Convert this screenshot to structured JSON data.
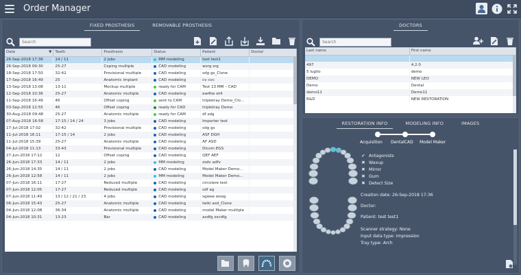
{
  "app": {
    "title": "Order Manager"
  },
  "left": {
    "tabs": [
      "FIXED PROSTHESIS",
      "REMOVABLE PROSTHESIS"
    ],
    "active_tab": 0,
    "search": {
      "placeholder": "Search",
      "value": ""
    },
    "columns": [
      "Date",
      "Teeth",
      "Prosthesis",
      "Status",
      "Patient",
      "Doctor"
    ],
    "rows": [
      {
        "date": "26-Sep-2018 17:36",
        "teeth": "14 / 11",
        "prosthesis": "2 jobs",
        "status": "MM modeling",
        "color": "#29c6e0",
        "patient": "test test1",
        "doctor": ""
      },
      {
        "date": "26-Sep-2018 09:30",
        "teeth": "25-27",
        "prosthesis": "Coping multiple",
        "status": "CAD modeling",
        "color": "#1f5fb0",
        "patient": "wsrg srg",
        "doctor": ""
      },
      {
        "date": "18-Sep-2018 17:50",
        "teeth": "32-42",
        "prosthesis": "Provisional multiple",
        "status": "CAD modeling",
        "color": "#1f5fb0",
        "patient": "sdg gs_Clone",
        "doctor": ""
      },
      {
        "date": "17-Sep-2018 16:49",
        "teeth": "25",
        "prosthesis": "Anatomic implant",
        "status": "CAD modeling",
        "color": "#1f5fb0",
        "patient": "cv cvc",
        "doctor": ""
      },
      {
        "date": "13-Sep-2018 13:08",
        "teeth": "13-11",
        "prosthesis": "Mockup multiple",
        "status": "ready for CAM",
        "color": "#3ccf3c",
        "patient": "Test 13 MM – CAD",
        "doctor": ""
      },
      {
        "date": "12-Sep-2018 10:36",
        "teeth": "25-27",
        "prosthesis": "Anatomic multiple",
        "status": "CAD modeling",
        "color": "#1f5fb0",
        "patient": "ew4tw et4",
        "doctor": ""
      },
      {
        "date": "11-Sep-2018 16:49",
        "teeth": "46",
        "prosthesis": "Offset coping",
        "status": "sent to CAM",
        "color": "#3ccf3c",
        "patient": "tripletray Demo_Clo...",
        "doctor": ""
      },
      {
        "date": "03-Sep-2018 12:55",
        "teeth": "46",
        "prosthesis": "Offset coping",
        "status": "ready for CAD",
        "color": "#2e7d32",
        "patient": "tripletray Demo",
        "doctor": ""
      },
      {
        "date": "30-Aug-2018 09:48",
        "teeth": "25-27",
        "prosthesis": "Anatomic multiple",
        "status": "ready for CAM",
        "color": "#3ccf3c",
        "patient": "df sdg",
        "doctor": ""
      },
      {
        "date": "07-Aug-2018 16:58",
        "teeth": "17-15 / 14 / 24",
        "prosthesis": "3 jobs",
        "status": "CAD modeling",
        "color": "#1f5fb0",
        "patient": "Importer test",
        "doctor": ""
      },
      {
        "date": "17-Jul-2018 17:02",
        "teeth": "32-42",
        "prosthesis": "Provisional multiple",
        "status": "CAD modeling",
        "color": "#1f5fb0",
        "patient": "sdg gs",
        "doctor": ""
      },
      {
        "date": "11-Jul-2018 16:11",
        "teeth": "17-15 / 14",
        "prosthesis": "2 jobs",
        "status": "CAD modeling",
        "color": "#1f5fb0",
        "patient": "ASF DGH",
        "doctor": ""
      },
      {
        "date": "11-Jul-2018 15:39",
        "teeth": "25-27",
        "prosthesis": "Anatomic multiple",
        "status": "CAD modeling",
        "color": "#1f5fb0",
        "patient": "AF ASD",
        "doctor": ""
      },
      {
        "date": "04-Jul-2018 11:13",
        "teeth": "33-43",
        "prosthesis": "Provisional multiple",
        "status": "CAD modeling",
        "color": "#1f5fb0",
        "patient": "Dicom EGS",
        "doctor": ""
      },
      {
        "date": "27-Jun-2018 17:12",
        "teeth": "12",
        "prosthesis": "Offset coping",
        "status": "CAD modeling",
        "color": "#1f5fb0",
        "patient": "QEF AEF",
        "doctor": ""
      },
      {
        "date": "26-Jun-2018 17:33",
        "teeth": "14 / 11",
        "prosthesis": "2 jobs",
        "status": "MM modeling",
        "color": "#29c6e0",
        "patient": "zsdv adfv",
        "doctor": ""
      },
      {
        "date": "26-Jun-2018 14:35",
        "teeth": "14 / 11",
        "prosthesis": "2 jobs",
        "status": "CAD modeling",
        "color": "#1f5fb0",
        "patient": "Model Maker Demo...",
        "doctor": ""
      },
      {
        "date": "26-Jun-2018 12:58",
        "teeth": "14 / 11",
        "prosthesis": "2 jobs",
        "status": "MM modeling",
        "color": "#29c6e0",
        "patient": "Model Maker Demo...",
        "doctor": ""
      },
      {
        "date": "07-Jun-2018 16:11",
        "teeth": "17-27",
        "prosthesis": "Reduced multiple",
        "status": "CAD modeling",
        "color": "#1f5fb0",
        "patient": "circolare test",
        "doctor": ""
      },
      {
        "date": "07-Jun-2018 12:05",
        "teeth": "17-27",
        "prosthesis": "Reduced multiple",
        "status": "CAD modeling",
        "color": "#1f5fb0",
        "patient": "sdf ag",
        "doctor": ""
      },
      {
        "date": "07-Jun-2018 11:49",
        "teeth": "13 / 12 / 21 / 23",
        "prosthesis": "4 jobs",
        "status": "CAD modeling",
        "color": "#1f5fb0",
        "patient": "sgwee wseg",
        "doctor": ""
      },
      {
        "date": "06-Jun-2018 15:43",
        "teeth": "25-27",
        "prosthesis": "Anatomic multiple",
        "status": "CAD modeling",
        "color": "#1f5fb0",
        "patient": "lwiki asd_Clone",
        "doctor": ""
      },
      {
        "date": "04-Jun-2018 12:08",
        "teeth": "36-34",
        "prosthesis": "Anatomic multiple",
        "status": "CAD modeling",
        "color": "#1f5fb0",
        "patient": "model Maker multiple",
        "doctor": ""
      },
      {
        "date": "04-Jun-2018 10:31",
        "teeth": "13-23",
        "prosthesis": "Bar",
        "status": "CAD modeling",
        "color": "#1f5fb0",
        "patient": "asdfg zxcdfg",
        "doctor": ""
      }
    ],
    "selected_row": 0
  },
  "doctors": {
    "tab": "DOCTORS",
    "search": {
      "placeholder": "Search",
      "value": ""
    },
    "columns": [
      "Last name",
      "First name"
    ],
    "rows": [
      {
        "last": "",
        "first": ""
      },
      {
        "last": "497",
        "first": "4.2.0"
      },
      {
        "last": "5 luglio",
        "first": "demo"
      },
      {
        "last": "DEMO",
        "first": "NEW LEO"
      },
      {
        "last": "Demo",
        "first": "Dental"
      },
      {
        "last": "demo11",
        "first": "Demo11"
      },
      {
        "last": "R&D",
        "first": "NEW RESTORATION"
      }
    ],
    "selected_row": 0
  },
  "info": {
    "tabs": [
      "RESTORATION INFO",
      "MODELING INFO",
      "IMAGES"
    ],
    "active_tab": 0,
    "steps": [
      "Acquisition",
      "DentalCAD",
      "Model Maker"
    ],
    "checks": [
      {
        "label": "Antagonists",
        "state": "check"
      },
      {
        "label": "Waxup",
        "state": "cross"
      },
      {
        "label": "Mirror",
        "state": "cross"
      },
      {
        "label": "Gum",
        "state": "cross"
      },
      {
        "label": "Detect Size",
        "state": "cross"
      }
    ],
    "creation_date": "Creation date: 26-Sep-2018 17:36",
    "doctor": "Doctor:",
    "patient": "Patient: test test1",
    "scanner_strategy": "Scanner strategy: None",
    "input_type": "Input data type: Impression",
    "tray_type": "Tray type: Arch"
  },
  "colors": {
    "accent": "#1f5fb0",
    "selection": "#b9daf0",
    "panel": "#46546a",
    "background": "#4d5b70"
  }
}
